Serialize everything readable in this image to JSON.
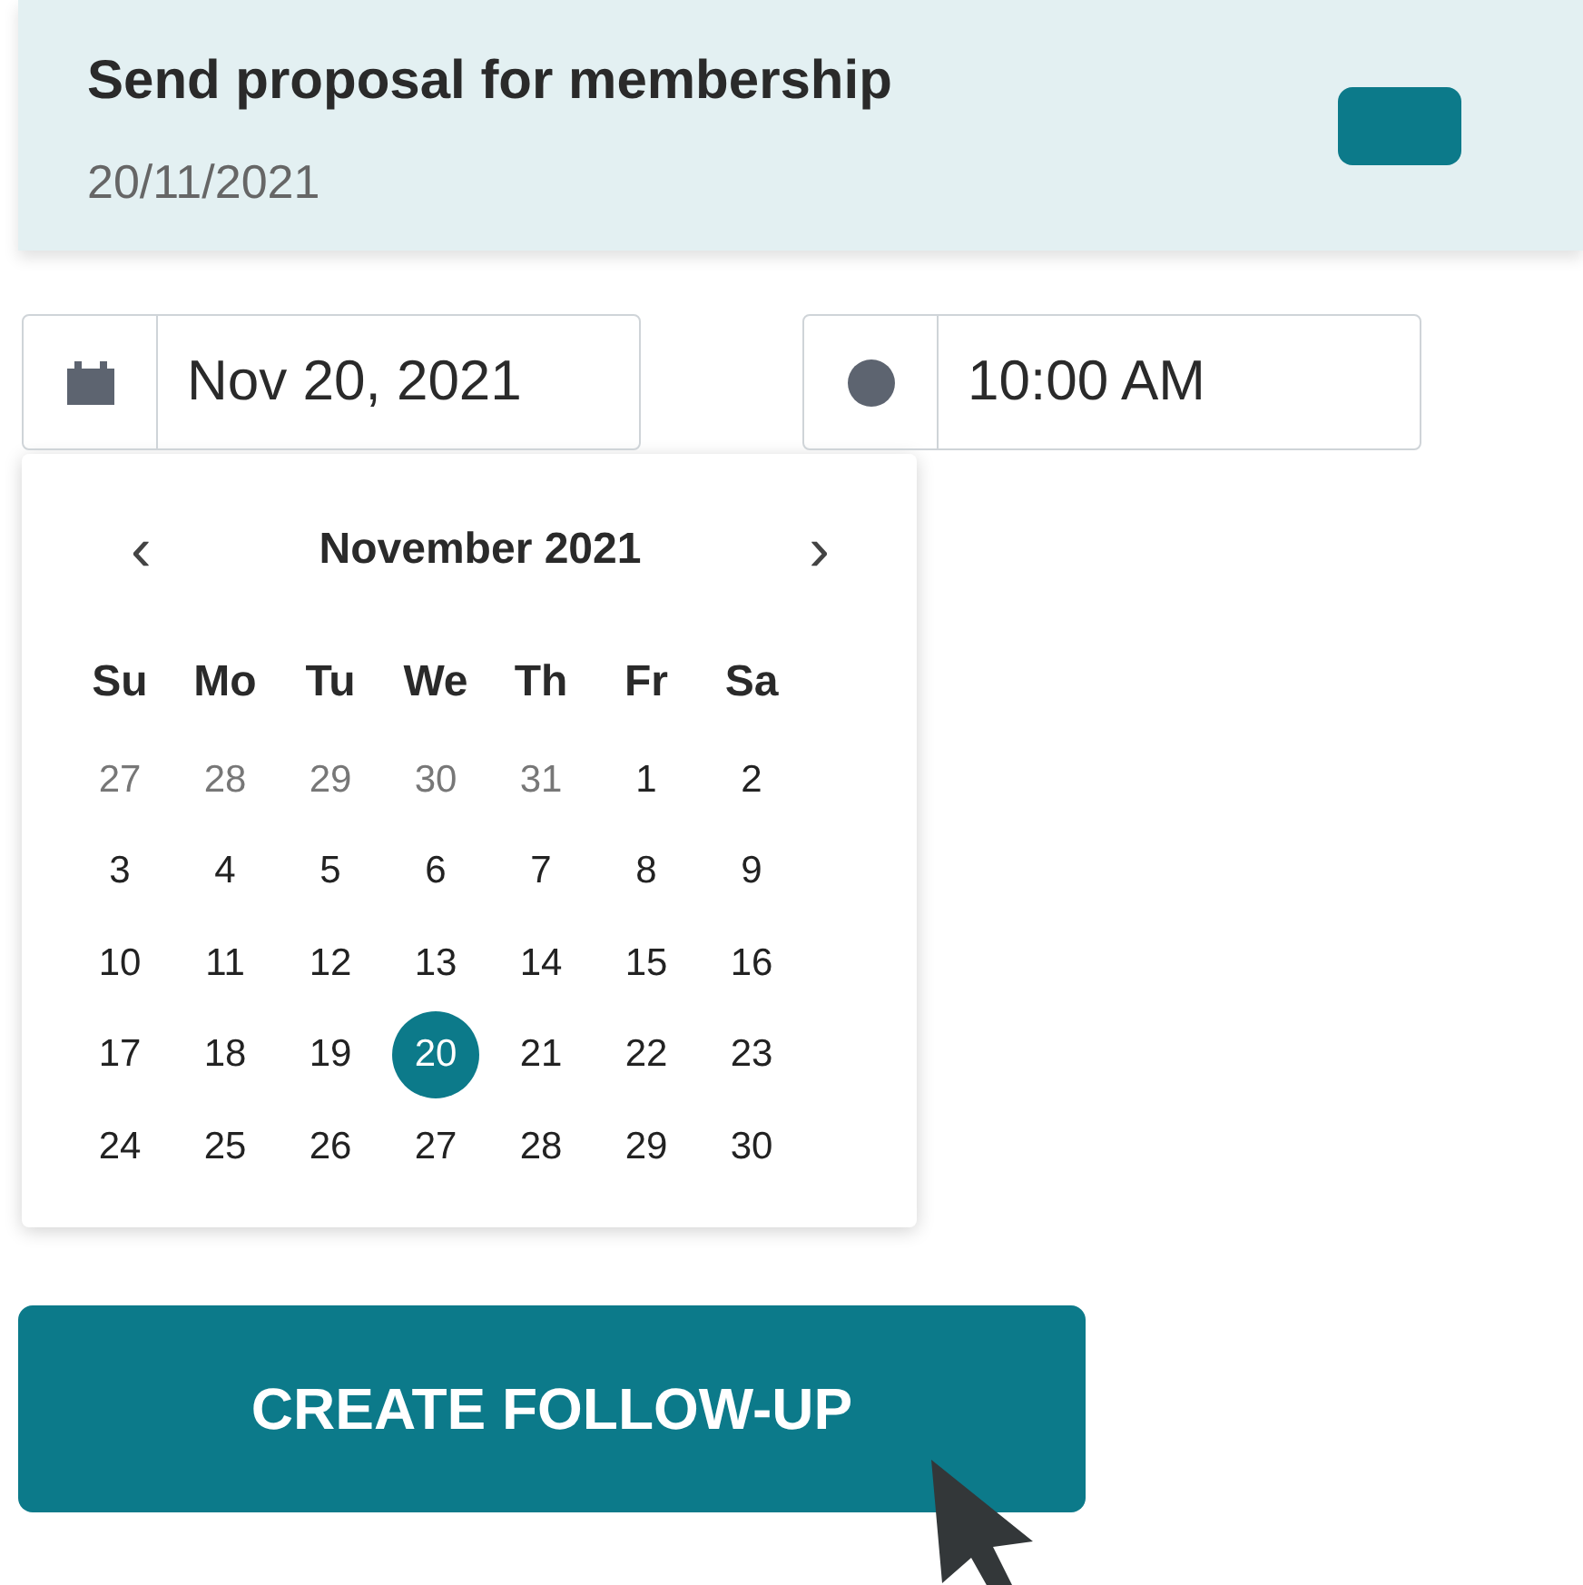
{
  "task_card": {
    "title": "Send proposal for membership",
    "date": "20/11/2021"
  },
  "date_field": {
    "value": "Nov 20, 2021"
  },
  "time_field": {
    "value": "10:00 AM"
  },
  "calendar": {
    "prev": "‹",
    "month": "November 2021",
    "next": "›",
    "weekdays": [
      "Su",
      "Mo",
      "Tu",
      "We",
      "Th",
      "Fr",
      "Sa"
    ],
    "days": [
      {
        "label": "27",
        "outside": true,
        "selected": false
      },
      {
        "label": "28",
        "outside": true,
        "selected": false
      },
      {
        "label": "29",
        "outside": true,
        "selected": false
      },
      {
        "label": "30",
        "outside": true,
        "selected": false
      },
      {
        "label": "31",
        "outside": true,
        "selected": false
      },
      {
        "label": "1",
        "outside": false,
        "selected": false
      },
      {
        "label": "2",
        "outside": false,
        "selected": false
      },
      {
        "label": "3",
        "outside": false,
        "selected": false
      },
      {
        "label": "4",
        "outside": false,
        "selected": false
      },
      {
        "label": "5",
        "outside": false,
        "selected": false
      },
      {
        "label": "6",
        "outside": false,
        "selected": false
      },
      {
        "label": "7",
        "outside": false,
        "selected": false
      },
      {
        "label": "8",
        "outside": false,
        "selected": false
      },
      {
        "label": "9",
        "outside": false,
        "selected": false
      },
      {
        "label": "10",
        "outside": false,
        "selected": false
      },
      {
        "label": "11",
        "outside": false,
        "selected": false
      },
      {
        "label": "12",
        "outside": false,
        "selected": false
      },
      {
        "label": "13",
        "outside": false,
        "selected": false
      },
      {
        "label": "14",
        "outside": false,
        "selected": false
      },
      {
        "label": "15",
        "outside": false,
        "selected": false
      },
      {
        "label": "16",
        "outside": false,
        "selected": false
      },
      {
        "label": "17",
        "outside": false,
        "selected": false
      },
      {
        "label": "18",
        "outside": false,
        "selected": false
      },
      {
        "label": "19",
        "outside": false,
        "selected": false
      },
      {
        "label": "20",
        "outside": false,
        "selected": true
      },
      {
        "label": "21",
        "outside": false,
        "selected": false
      },
      {
        "label": "22",
        "outside": false,
        "selected": false
      },
      {
        "label": "23",
        "outside": false,
        "selected": false
      },
      {
        "label": "24",
        "outside": false,
        "selected": false
      },
      {
        "label": "25",
        "outside": false,
        "selected": false
      },
      {
        "label": "26",
        "outside": false,
        "selected": false
      },
      {
        "label": "27",
        "outside": false,
        "selected": false
      },
      {
        "label": "28",
        "outside": false,
        "selected": false
      },
      {
        "label": "29",
        "outside": false,
        "selected": false
      },
      {
        "label": "30",
        "outside": false,
        "selected": false
      }
    ]
  },
  "button": {
    "label": "CREATE FOLLOW-UP"
  }
}
